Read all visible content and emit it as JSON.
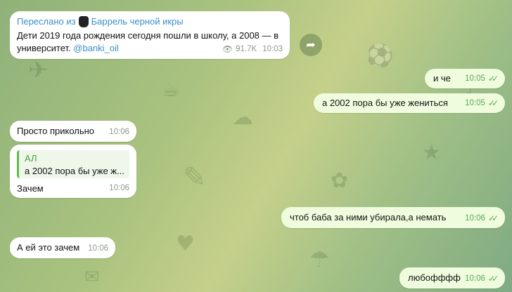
{
  "messages": {
    "forwarded": {
      "forward_prefix": "Переслано из",
      "channel_name": "Баррель черной икры",
      "text": "Дети 2019 года рождения сегодня пошли в школу, а 2008 — в университет.",
      "link": "@banki_oil",
      "views": "91.7K",
      "time": "10:03"
    },
    "m1": {
      "text": "и че",
      "time": "10:05"
    },
    "m2": {
      "text": "а 2002 пора бы уже жениться",
      "time": "10:05"
    },
    "m3": {
      "text": "Просто прикольно",
      "time": "10:06"
    },
    "m4": {
      "reply_name": "АЛ",
      "reply_text": "а 2002 пора бы уже ж...",
      "text": "Зачем",
      "time": "10:06"
    },
    "m5": {
      "text": "чтоб баба за ними убирала,а немать",
      "time": "10:06"
    },
    "m6": {
      "text": "А ей это зачем",
      "time": "10:06"
    },
    "m7": {
      "text": "любофффф",
      "time": "10:06"
    }
  },
  "icons": {
    "share": "share-icon",
    "views": "eye-icon",
    "read": "double-check-icon",
    "channel": "channel-avatar-icon"
  },
  "colors": {
    "incoming": "#ffffff",
    "outgoing": "#effdde",
    "accent": "#3a8fc6",
    "check": "#5fa458"
  }
}
